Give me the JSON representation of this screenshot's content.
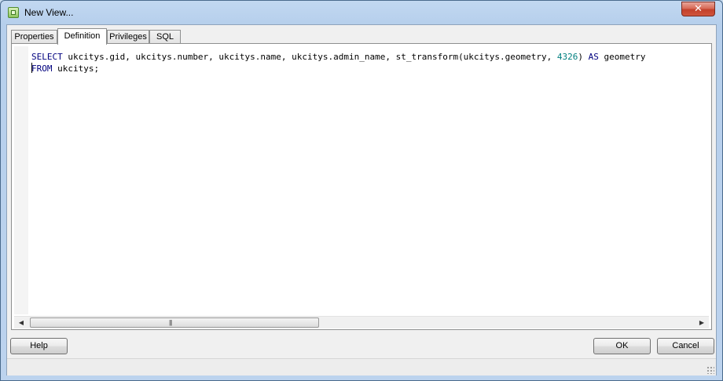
{
  "window": {
    "title": "New View...",
    "close_symbol": "✕"
  },
  "tabs": [
    {
      "label": "Properties",
      "active": false
    },
    {
      "label": "Definition",
      "active": true
    },
    {
      "label": "Privileges",
      "active": false
    },
    {
      "label": "SQL",
      "active": false
    }
  ],
  "editor": {
    "line1": {
      "kw_select": "SELECT",
      "text_a": " ukcitys.gid, ukcitys.number, ukcitys.name, ukcitys.admin_name, st_transform(ukcitys.geometry, ",
      "num": "4326",
      "text_b": ") ",
      "kw_as": "AS",
      "text_c": " geometry"
    },
    "line2": {
      "kw_from_first": "F",
      "kw_from_rest": "ROM",
      "text": " ukcitys;"
    }
  },
  "scrollbar": {
    "left_arrow": "◀",
    "right_arrow": "▶",
    "grip": "|||"
  },
  "buttons": {
    "help": "Help",
    "ok": "OK",
    "cancel": "Cancel"
  },
  "colors": {
    "keyword": "#00007f",
    "number": "#007f7f"
  },
  "icons": {
    "app": "view-icon",
    "close": "close-icon"
  }
}
